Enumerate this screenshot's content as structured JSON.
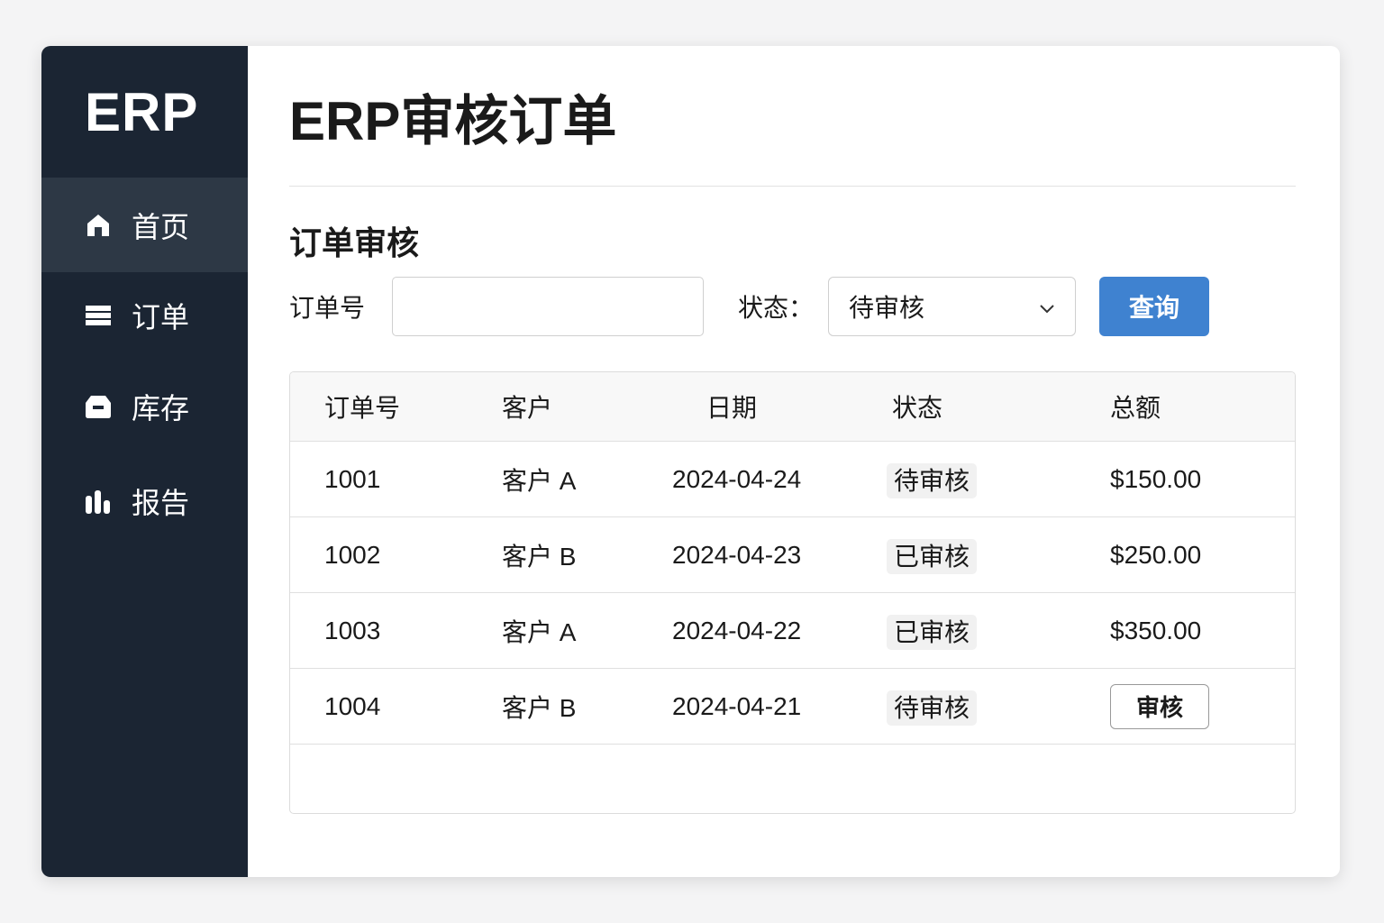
{
  "sidebar": {
    "logo": "ERP",
    "items": [
      {
        "label": "首页",
        "icon": "home-icon"
      },
      {
        "label": "订单",
        "icon": "list-icon"
      },
      {
        "label": "库存",
        "icon": "inventory-icon"
      },
      {
        "label": "报告",
        "icon": "bar-chart-icon"
      }
    ]
  },
  "header": {
    "title": "ERP审核订单"
  },
  "section": {
    "title": "订单审核"
  },
  "filter": {
    "order_label": "订单号",
    "order_value": "",
    "status_label": "状态：",
    "status_value": "待审核",
    "query_button": "查询"
  },
  "table": {
    "headers": [
      "订单号",
      "客户",
      "日期",
      "状态",
      "总额"
    ],
    "rows": [
      {
        "id": "1001",
        "customer": "客户 A",
        "date": "2024-04-24",
        "status": "待审核",
        "total": "$150.00"
      },
      {
        "id": "1002",
        "customer": "客户 B",
        "date": "2024-04-23",
        "status": "已审核",
        "total": "$250.00"
      },
      {
        "id": "1003",
        "customer": "客户 A",
        "date": "2024-04-22",
        "status": "已审核",
        "total": "$350.00"
      },
      {
        "id": "1004",
        "customer": "客户 B",
        "date": "2024-04-21",
        "status": "待审核",
        "action": "审核"
      }
    ]
  },
  "colors": {
    "sidebar": "#1b2533",
    "active": "#2d3845",
    "accent": "#3f82d0"
  }
}
